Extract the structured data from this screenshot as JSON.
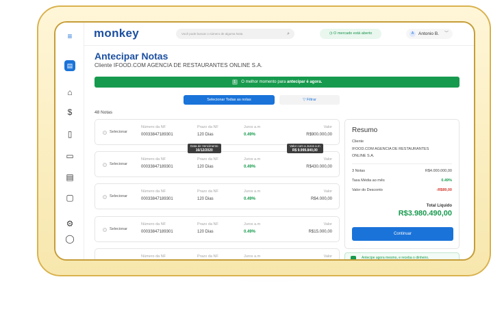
{
  "app": {
    "logo": "monkey"
  },
  "topbar": {
    "search_placeholder": "Você pode buscar o número de alguma Nota",
    "market_status": "O mercado está aberto",
    "user_initial": "A",
    "user_name": "Antonio B."
  },
  "page": {
    "title": "Antecipar Notas",
    "client_line": "Cliente IFOOD.COM AGENCIA DE RESTAURANTES ONLINE S.A.",
    "banner_number": "1",
    "banner_text": "O melhor momento para",
    "banner_bold": "antecipar é agora.",
    "select_all_label": "Selecionar Todas as notas",
    "filter_label": "Filtrar",
    "count_label": "48 Notas"
  },
  "columns": {
    "select": "Selecionar",
    "nf": "Número da NF",
    "prazo": "Prazo da NF",
    "juros": "Juros a.m",
    "valor": "Valor"
  },
  "notes": [
    {
      "nf": "00033847189301",
      "prazo": "120 Dias",
      "juros": "0.49%",
      "valor": "R$900.000,00"
    },
    {
      "nf": "00033847189301",
      "prazo": "120 Dias",
      "juros": "0.49%",
      "valor": "R$430.000,00"
    },
    {
      "nf": "00033847189301",
      "prazo": "120 Dias",
      "juros": "0.49%",
      "valor": "R$4.000,00"
    },
    {
      "nf": "00033847189301",
      "prazo": "120 Dias",
      "juros": "0.49%",
      "valor": "R$15.000,00"
    },
    {
      "nf": "",
      "prazo": "",
      "juros": "",
      "valor": ""
    }
  ],
  "tooltips": {
    "due_label": "Data de Vencimento",
    "due_value": "16/12/2020",
    "value_label": "Valor com a Juros a.m",
    "value_value": "R$ 9.999.840,00"
  },
  "summary": {
    "title": "Resumo",
    "client_label": "Cliente",
    "client_name": "IFOOD.COM AGENCIA DE RESTAURANTES ONLINE S.A.",
    "notes_label": "3 Notas",
    "notes_value": "R$4.000.000,00",
    "rate_label": "Taxa Média ao mês",
    "rate_value": "0.49%",
    "discount_label": "Valor do Desconto",
    "discount_value": "-R$89,00",
    "total_label": "Total Líquido",
    "total_value": "R$3.980.490,00",
    "continue_label": "Continuar"
  },
  "promo": {
    "text": "Antecipe agora mesmo, e receba o dinheiro."
  },
  "colors": {
    "brand_blue": "#1a73d9",
    "green": "#169a4d",
    "frame_gold": "#d9b24f"
  }
}
